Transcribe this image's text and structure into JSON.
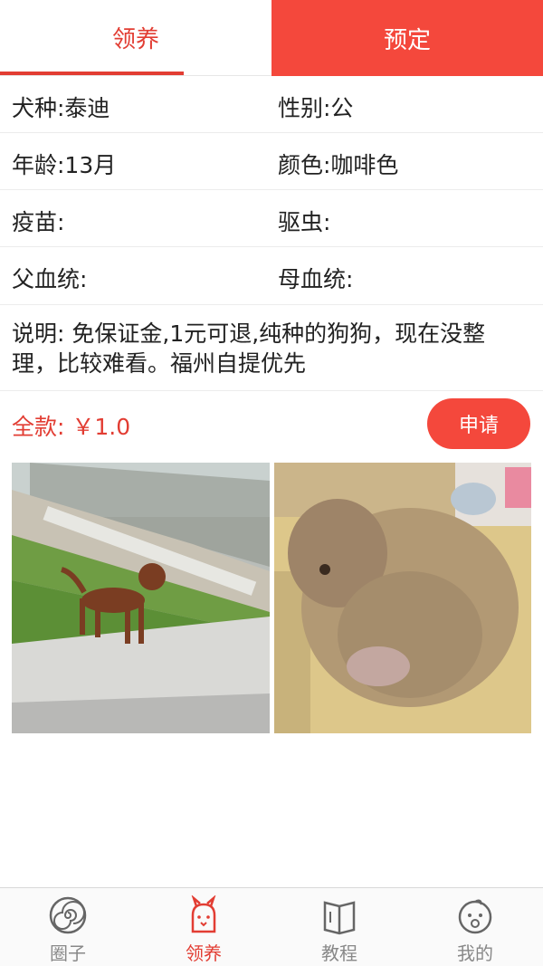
{
  "tabs": [
    {
      "label": "领养",
      "active": true
    },
    {
      "label": "预定",
      "active": false
    }
  ],
  "details": {
    "breed": "犬种:泰迪",
    "gender": "性别:公",
    "age": "年龄:13月",
    "color": "颜色:咖啡色",
    "vaccine": "疫苗:",
    "deworm": "驱虫:",
    "father": "父血统:",
    "mother": "母血统:"
  },
  "description": "说明: 免保证金,1元可退,纯种的狗狗，现在没整理，比较难看。福州自提优先",
  "price": "全款: ￥1.0",
  "apply_label": "申请",
  "nav": [
    {
      "label": "圈子",
      "icon": "spiral-icon"
    },
    {
      "label": "领养",
      "icon": "bunny-icon",
      "active": true
    },
    {
      "label": "教程",
      "icon": "book-icon"
    },
    {
      "label": "我的",
      "icon": "baby-face-icon"
    }
  ],
  "colors": {
    "accent": "#f4483c",
    "accent_text": "#e23d33"
  }
}
